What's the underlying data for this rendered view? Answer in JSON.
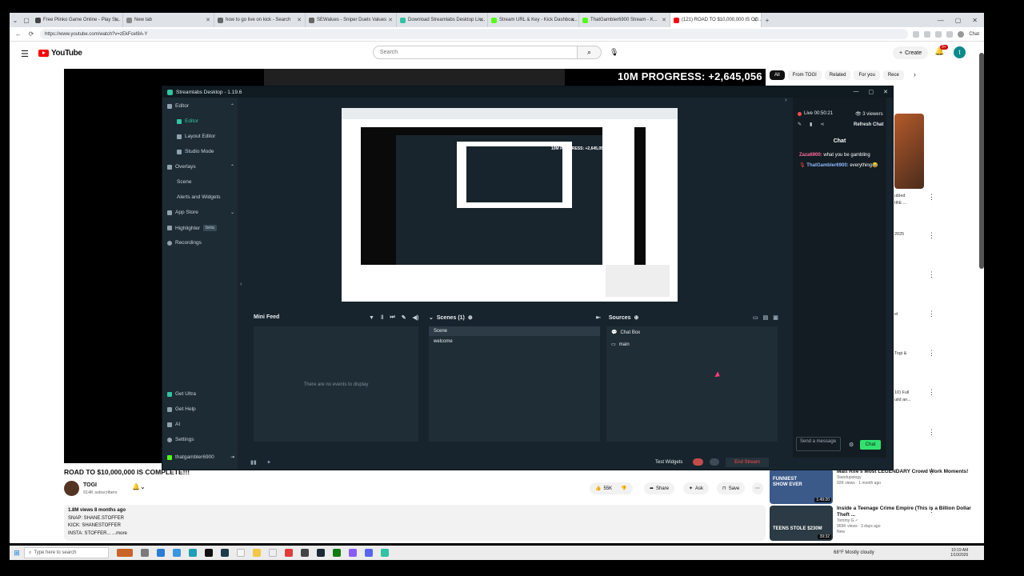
{
  "browser": {
    "tabs": [
      {
        "label": "Free Plinko Game Online - Play St...",
        "color": "#444"
      },
      {
        "label": "New tab",
        "color": "#888"
      },
      {
        "label": "how to go live on kick - Search",
        "color": "#666"
      },
      {
        "label": "SEWalues - Sniper Duels Values",
        "color": "#666"
      },
      {
        "label": "Download Streamlabs Desktop Liv...",
        "color": "#31c3a2"
      },
      {
        "label": "Stream URL & Key - Kick Dashboa...",
        "color": "#53fc18"
      },
      {
        "label": "ThatGambler6900 Stream - K...",
        "color": "#53fc18"
      },
      {
        "label": "(121) ROAD TO $10,000,000 IS CO...",
        "color": "#ff0000"
      }
    ],
    "url": "https://www.youtube.com/watch?v=zEkFcel9A-Y",
    "profile_label": "Chat"
  },
  "youtube": {
    "logo_text": "YouTube",
    "search_placeholder": "Search",
    "create_label": "Create",
    "notif_count": "9+",
    "avatar_letter": "t",
    "overlay_progress": "10M PROGRESS: +2,645,056",
    "video_title": "ROAD TO $10,000,000 IS COMPLETE!!!",
    "channel": "TOGI",
    "subscribers": "914K subscribers",
    "likes": "55K",
    "share": "Share",
    "ask": "Ask",
    "save": "Save",
    "desc_line1": "1.8M views  8 months ago",
    "desc_line2": "SNAP: SHANE.STOFFER",
    "desc_line3": "KICK: SHANESTOFFER",
    "desc_line4": "INSTA: STOFFER...  ...more",
    "chips": [
      "All",
      "From TOGI",
      "Related",
      "For you",
      "Rece"
    ],
    "side_snips": [
      "ubled",
      "IRE ...",
      "2025",
      "el",
      "Togi &",
      "10) Full",
      "uild an..."
    ],
    "recs": [
      {
        "title": "Matt Rife's Most LEGENDARY Crowd Work Moments!",
        "channel": "Standupology",
        "stats": "92K views · 1 month ago",
        "duration": "1:49:20",
        "thumb_text": "FUNNIEST SHOW EVER",
        "color": "#3b5a8a"
      },
      {
        "title": "Inside a Teenage Crime Empire (This is a Billion Dollar Theft ...",
        "channel": "Tommy G ✓",
        "stats": "969K views · 3 days ago",
        "badge": "New",
        "duration": "39:32",
        "thumb_text": "TEENS STOLE $230M",
        "color": "#2b3a44"
      }
    ]
  },
  "streamlabs": {
    "title": "Streamlabs Desktop - 1.19.6",
    "nav": [
      {
        "label": "Editor",
        "type": "section"
      },
      {
        "label": "Editor",
        "type": "sub",
        "active": true
      },
      {
        "label": "Layout Editor",
        "type": "sub"
      },
      {
        "label": "Studio Mode",
        "type": "sub"
      },
      {
        "label": "Overlays",
        "type": "section"
      },
      {
        "label": "Scene",
        "type": "sub"
      },
      {
        "label": "Alerts and Widgets",
        "type": "sub"
      },
      {
        "label": "App Store",
        "type": "section"
      },
      {
        "label": "Highlighter",
        "type": "section"
      },
      {
        "label": "Recordings",
        "type": "section"
      }
    ],
    "beta_label": "beta",
    "bottom_nav": [
      "Get Ultra",
      "Get Help",
      "AI",
      "Settings",
      "thatgambler6900"
    ],
    "docks": {
      "mini_feed": "Mini Feed",
      "mini_feed_empty": "There are no events to display",
      "scenes_title": "Scenes (1)",
      "scenes": [
        "Scene",
        "welcome"
      ],
      "sources_title": "Sources",
      "sources": [
        "Chat Box",
        "main"
      ]
    },
    "footer": {
      "test_widgets": "Test Widgets",
      "rec_label": "REC",
      "end_stream": "End Stream"
    },
    "chat": {
      "live": "Live 00:50:21",
      "viewers": "3 viewers",
      "refresh": "Refresh Chat",
      "title": "Chat",
      "msg1_user": "Zaza6900:",
      "msg1_text": "what you be gambling",
      "msg2_user": "ThatGambler6900:",
      "msg2_text": "everything😂",
      "send_placeholder": "Send a message",
      "chat_button": "Chat"
    }
  },
  "taskbar": {
    "search": "Type here to search",
    "weather": "68°F  Mostly cloudy",
    "time": "10:19 AM",
    "date": "1/10/2026"
  }
}
